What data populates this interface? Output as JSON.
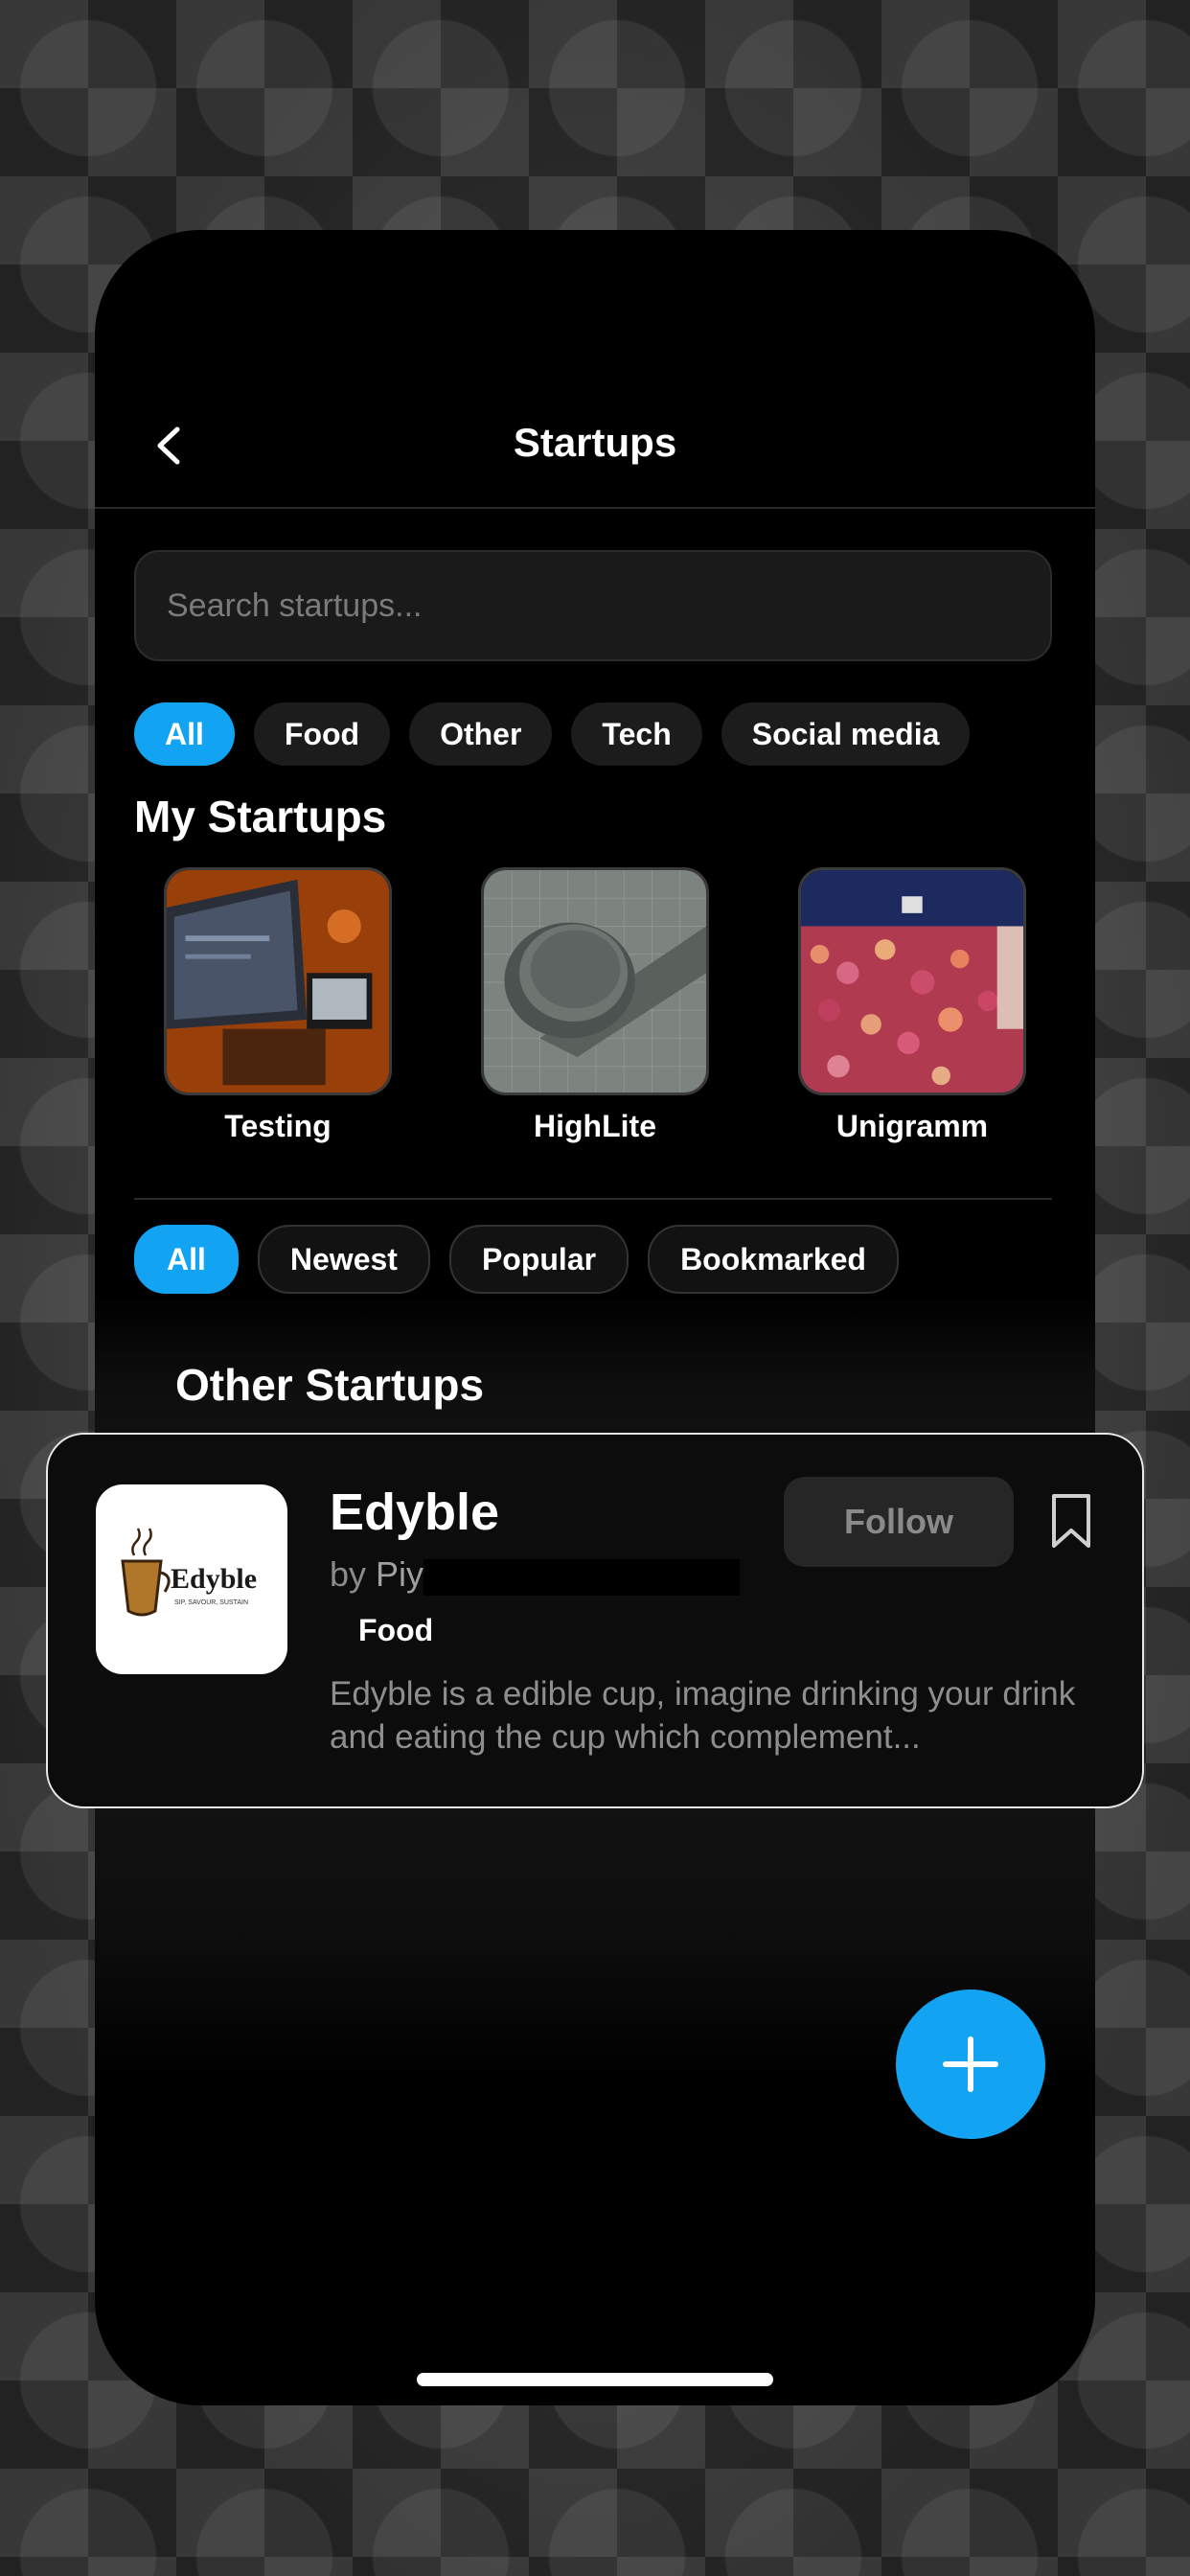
{
  "header": {
    "title": "Startups"
  },
  "search": {
    "placeholder": "Search startups..."
  },
  "category_filters": [
    {
      "label": "All",
      "active": true
    },
    {
      "label": "Food",
      "active": false
    },
    {
      "label": "Other",
      "active": false
    },
    {
      "label": "Tech",
      "active": false
    },
    {
      "label": "Social media",
      "active": false
    }
  ],
  "my_startups": {
    "title": "My Startups",
    "items": [
      {
        "label": "Testing",
        "image": "desk-computer-photo"
      },
      {
        "label": "HighLite",
        "image": "puck-device-photo"
      },
      {
        "label": "Unigramm",
        "image": "crowd-photo"
      }
    ]
  },
  "sort_filters": [
    {
      "label": "All",
      "active": true
    },
    {
      "label": "Newest",
      "active": false
    },
    {
      "label": "Popular",
      "active": false
    },
    {
      "label": "Bookmarked",
      "active": false
    }
  ],
  "other_startups": {
    "title": "Other Startups"
  },
  "card": {
    "name": "Edyble",
    "by_prefix": "by",
    "author": "Piyush",
    "tag": "Food",
    "description": "Edyble is a edible cup, imagine drinking your drink and eating the cup which complement...",
    "follow_label": "Follow",
    "logo": {
      "wordmark": "Edyble",
      "tagline": "SIP, SAVOUR, SUSTAIN"
    }
  },
  "colors": {
    "accent": "#12a4f2",
    "background": "#000000",
    "chip": "#1c1c1c"
  },
  "icons": {
    "back": "chevron-left-icon",
    "bookmark": "bookmark-icon",
    "add": "plus-icon"
  }
}
